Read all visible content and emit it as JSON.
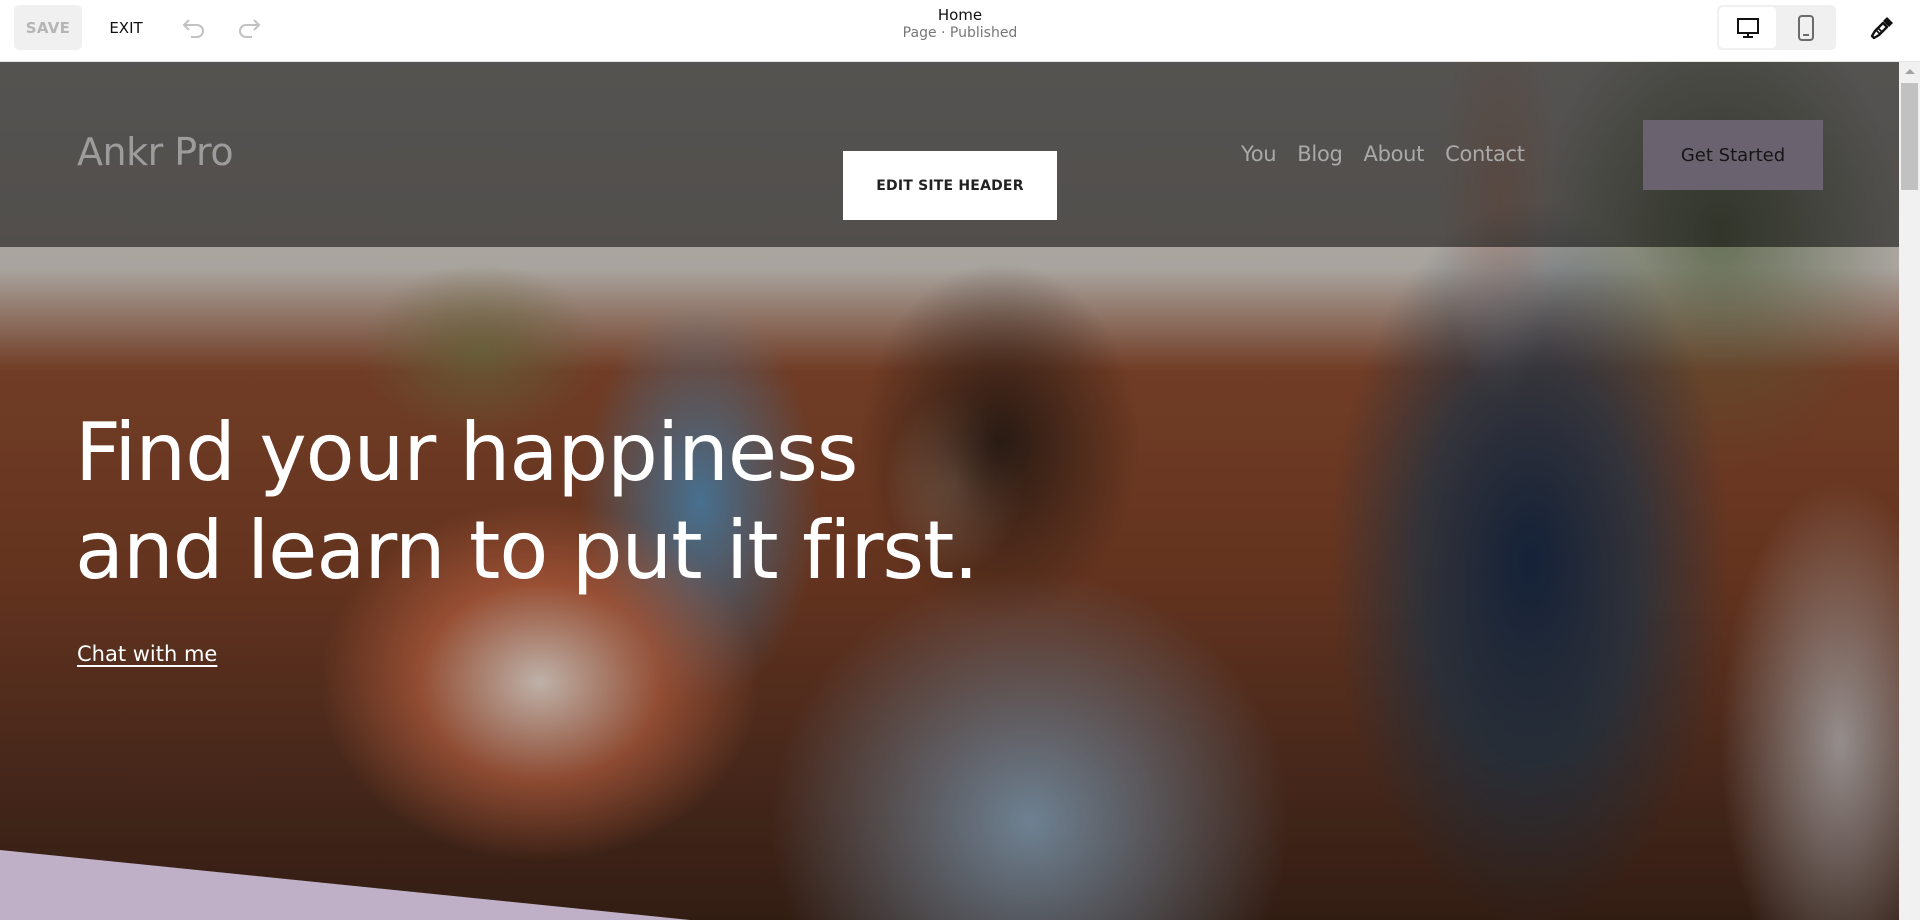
{
  "toolbar": {
    "save_label": "SAVE",
    "exit_label": "EXIT",
    "undo_icon": "undo-icon",
    "redo_icon": "redo-icon",
    "page_title": "Home",
    "page_status": "Page · Published",
    "device_desktop_icon": "desktop-icon",
    "device_mobile_icon": "mobile-icon",
    "design_icon": "paintbrush-icon",
    "active_device": "desktop"
  },
  "site_header": {
    "logo": "Ankr Pro",
    "edit_button_label": "EDIT SITE HEADER",
    "nav": [
      {
        "label": "You"
      },
      {
        "label": "Blog"
      },
      {
        "label": "About"
      },
      {
        "label": "Contact"
      }
    ],
    "cta_label": "Get Started"
  },
  "hero": {
    "headline_line1": "Find your happiness",
    "headline_line2": "and learn to put it first.",
    "link_label": "Chat with me",
    "accent_color": "#bfb0c8",
    "cta_color": "#6b6270"
  }
}
